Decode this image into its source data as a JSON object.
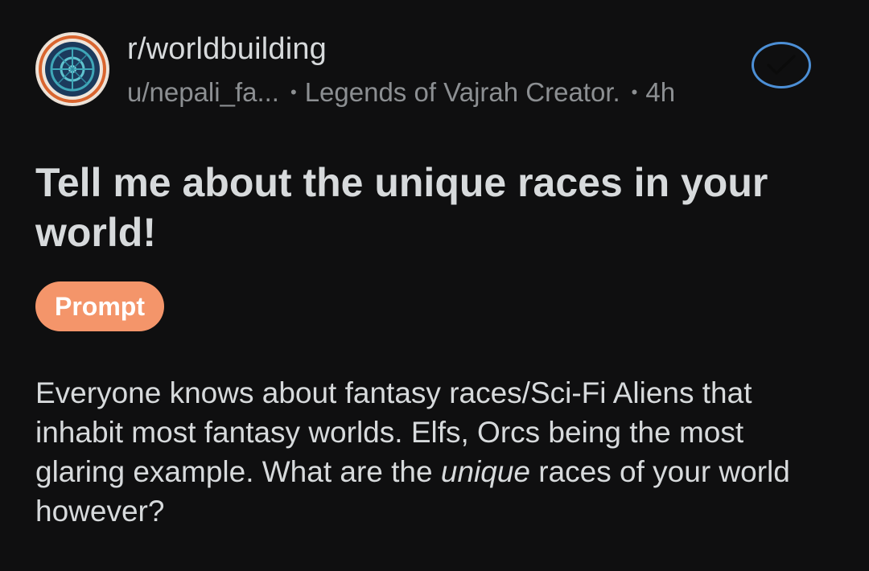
{
  "post": {
    "subreddit": "r/worldbuilding",
    "author": "u/nepali_fa...",
    "author_flair": "Legends of Vajrah Creator.",
    "age": "4h",
    "title": "Tell me about the unique races in your world!",
    "flair": "Prompt",
    "body_before": "Everyone knows about fantasy races/Sci-Fi Aliens that inhabit most fantasy worlds. Elfs, Orcs being the most glaring example. What are the ",
    "body_emphasis": "unique",
    "body_after": " races of your world however?",
    "joined_icon": "checkmark-icon",
    "avatar_icon": "subreddit-emblem-icon"
  },
  "colors": {
    "background": "#0f0f10",
    "text": "#d7dadc",
    "meta": "#8c8f92",
    "flair_bg": "#f4956a",
    "join_border": "#4c8fd6"
  }
}
